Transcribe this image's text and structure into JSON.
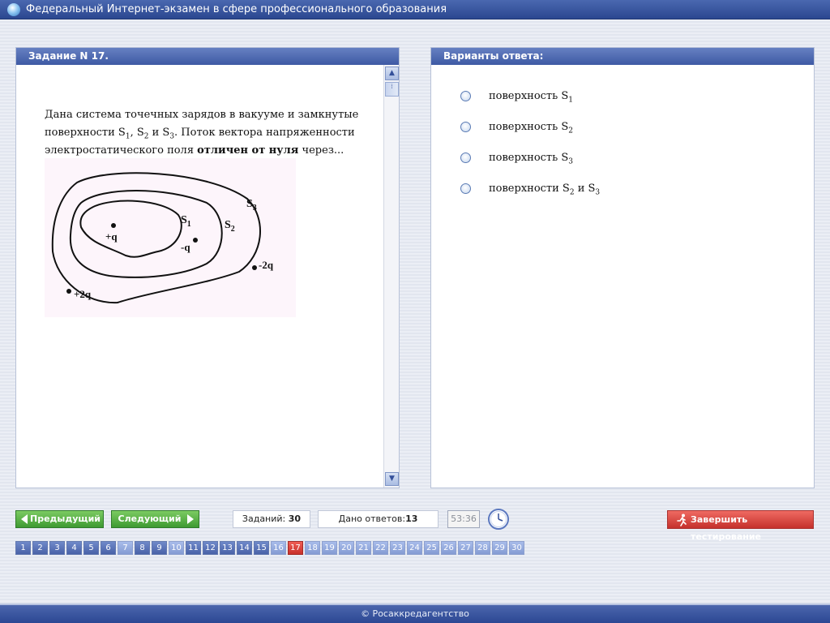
{
  "window": {
    "title": "Федеральный Интернет-экзамен в сфере профессионального образования"
  },
  "task_panel": {
    "header": "Задание N 17.",
    "text_part1": "Дана система точечных зарядов в вакууме и замкнутые поверхности S",
    "sub1": "1",
    "sep1": ", S",
    "sub2": "2",
    "sep2": " и S",
    "sub3": "3",
    "text_part2": ". Поток вектора напряженности электростатического поля ",
    "bold_text": "отличен от нуля",
    "text_part3": " через...",
    "figure": {
      "surface_labels": [
        {
          "main": "S",
          "sub": "1"
        },
        {
          "main": "S",
          "sub": "2"
        },
        {
          "main": "S",
          "sub": "3"
        }
      ],
      "charges": [
        "+q",
        "-q",
        "-2q",
        "+2q"
      ]
    }
  },
  "answers_panel": {
    "header": "Варианты ответа:",
    "options": [
      {
        "text": "поверхность S",
        "sub": "1"
      },
      {
        "text": "поверхность S",
        "sub": "2"
      },
      {
        "text": "поверхность S",
        "sub": "3"
      },
      {
        "text": "поверхности S",
        "sub": "2",
        "mid": " и S",
        "sub_b": "3"
      }
    ]
  },
  "controls": {
    "prev_label": "Предыдущий",
    "next_label": "Следующий",
    "total_label": "Заданий:",
    "total_value": "30",
    "answered_label": "Дано ответов:",
    "answered_value": "13",
    "timer": "53:36",
    "finish_label": "Завершить тестирование"
  },
  "pager": {
    "pages": [
      "1",
      "2",
      "3",
      "4",
      "5",
      "6",
      "7",
      "8",
      "9",
      "10",
      "11",
      "12",
      "13",
      "14",
      "15",
      "16",
      "17",
      "18",
      "19",
      "20",
      "21",
      "22",
      "23",
      "24",
      "25",
      "26",
      "27",
      "28",
      "29",
      "30"
    ],
    "current": "17"
  },
  "footer": {
    "text": "© Росаккредагентство"
  },
  "colors": {
    "header_blue": "#3e5aa4",
    "nav_green": "#3e9a32",
    "finish_red": "#c5312c",
    "page_current": "#c8302b"
  }
}
